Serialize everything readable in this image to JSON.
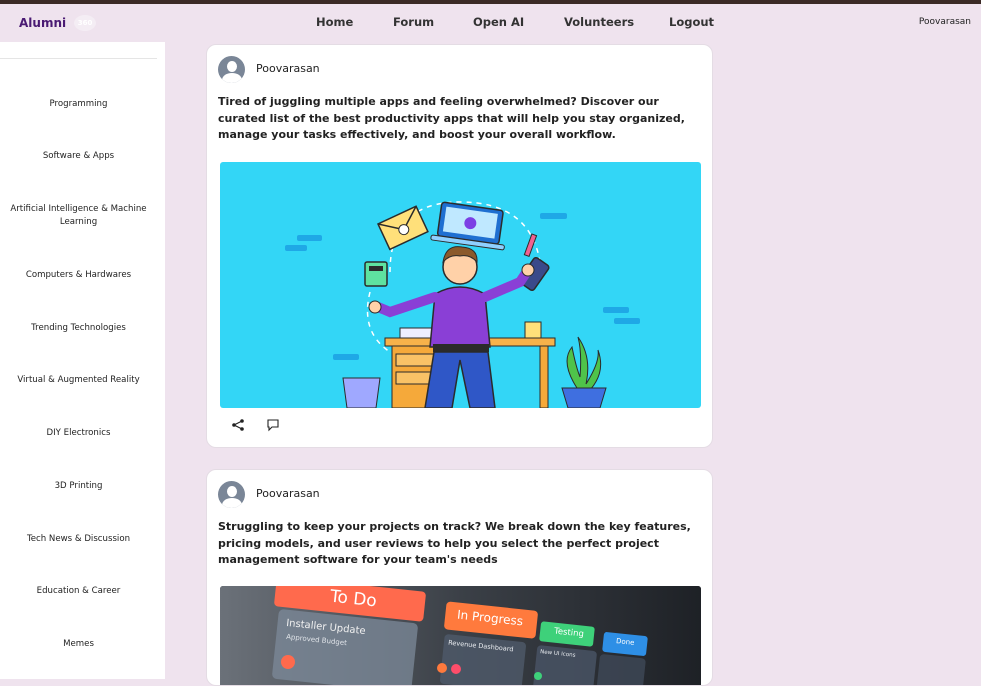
{
  "header": {
    "logo_text": "Alumni",
    "logo_badge": "360",
    "nav_links": [
      "Home",
      "Forum",
      "Open AI",
      "Volunteers",
      "Logout"
    ],
    "user_name": "Poovarasan"
  },
  "sidebar": {
    "categories": [
      "Programming",
      "Software & Apps",
      "Artificial Intelligence & Machine Learning",
      "Computers & Hardwares",
      "Trending Technologies",
      "Virtual & Augmented Reality",
      "DIY Electronics",
      "3D Printing",
      "Tech News & Discussion",
      "Education & Career",
      "Memes"
    ]
  },
  "posts": [
    {
      "author": "Poovarasan",
      "text": "Tired of juggling multiple apps and feeling overwhelmed? Discover our curated list of the best productivity apps that will help you stay organized, manage your tasks effectively, and boost your overall workflow.",
      "image_icon": "productivity-illustration"
    },
    {
      "author": "Poovarasan",
      "text": "Struggling to keep your projects on track? We break down the key features, pricing models, and user reviews to help you select the perfect project management software for your team's needs",
      "image_icon": "kanban-board-photo",
      "board_labels": {
        "todo": "To Do",
        "in_progress": "In Progress",
        "testing": "Testing",
        "done": "Done",
        "card1_title": "Installer Update",
        "card1_sub": "Approved Budget",
        "card2_title": "Revenue Dashboard",
        "card3_title": "New UI Icons"
      }
    }
  ],
  "colors": {
    "page_bg": "#efe3ee",
    "brand": "#4a1a73",
    "illustration_bg": "#33d6f6"
  }
}
